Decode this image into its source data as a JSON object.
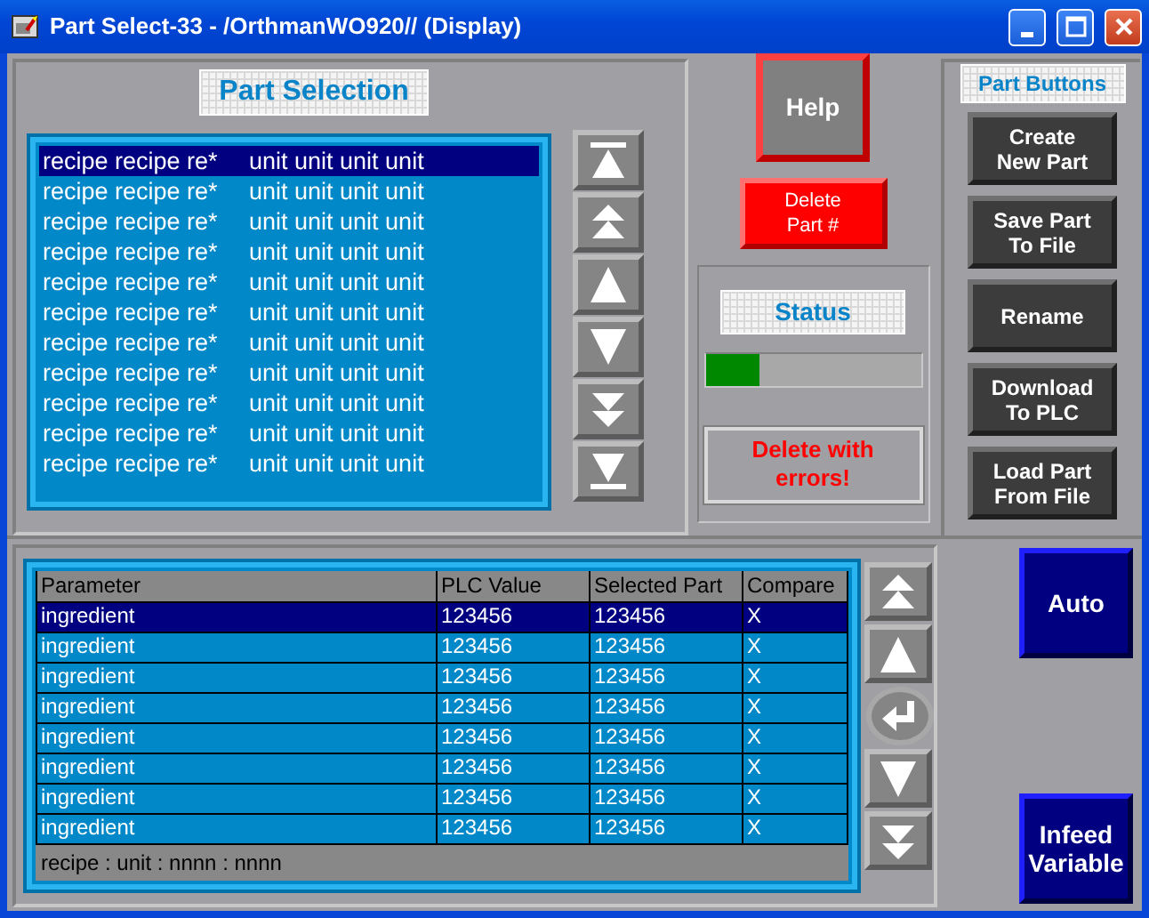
{
  "window": {
    "title": "Part Select-33 - /OrthmanWO920// (Display)"
  },
  "part_selection": {
    "title": "Part Selection",
    "items": [
      {
        "recipe": "recipe recipe re*",
        "unit": "unit unit unit unit",
        "selected": true
      },
      {
        "recipe": "recipe recipe re*",
        "unit": "unit unit unit unit",
        "selected": false
      },
      {
        "recipe": "recipe recipe re*",
        "unit": "unit unit unit unit",
        "selected": false
      },
      {
        "recipe": "recipe recipe re*",
        "unit": "unit unit unit unit",
        "selected": false
      },
      {
        "recipe": "recipe recipe re*",
        "unit": "unit unit unit unit",
        "selected": false
      },
      {
        "recipe": "recipe recipe re*",
        "unit": "unit unit unit unit",
        "selected": false
      },
      {
        "recipe": "recipe recipe re*",
        "unit": "unit unit unit unit",
        "selected": false
      },
      {
        "recipe": "recipe recipe re*",
        "unit": "unit unit unit unit",
        "selected": false
      },
      {
        "recipe": "recipe recipe re*",
        "unit": "unit unit unit unit",
        "selected": false
      },
      {
        "recipe": "recipe recipe re*",
        "unit": "unit unit unit unit",
        "selected": false
      },
      {
        "recipe": "recipe recipe re*",
        "unit": "unit unit unit unit",
        "selected": false
      }
    ],
    "scroll_buttons": [
      {
        "kind": "top"
      },
      {
        "kind": "page_up"
      },
      {
        "kind": "up"
      },
      {
        "kind": "down"
      },
      {
        "kind": "page_down"
      },
      {
        "kind": "bottom"
      }
    ]
  },
  "help_button": "Help",
  "delete_button": [
    "Delete",
    "Part #"
  ],
  "status": {
    "title": "Status",
    "level": 0.25,
    "message": "Delete with errors!"
  },
  "part_buttons": {
    "title": "Part Buttons",
    "buttons": [
      [
        "Create",
        "New Part"
      ],
      [
        "Save Part",
        "To File"
      ],
      [
        "Rename"
      ],
      [
        "Download",
        "To PLC"
      ],
      [
        "Load Part",
        "From File"
      ]
    ]
  },
  "parameters": {
    "columns": [
      "Parameter",
      "PLC Value",
      "Selected Part",
      "Compare"
    ],
    "rows": [
      {
        "cells": [
          "ingredient",
          "123456",
          "123456",
          "X"
        ],
        "selected": true
      },
      {
        "cells": [
          "ingredient",
          "123456",
          "123456",
          "X"
        ],
        "selected": false
      },
      {
        "cells": [
          "ingredient",
          "123456",
          "123456",
          "X"
        ],
        "selected": false
      },
      {
        "cells": [
          "ingredient",
          "123456",
          "123456",
          "X"
        ],
        "selected": false
      },
      {
        "cells": [
          "ingredient",
          "123456",
          "123456",
          "X"
        ],
        "selected": false
      },
      {
        "cells": [
          "ingredient",
          "123456",
          "123456",
          "X"
        ],
        "selected": false
      },
      {
        "cells": [
          "ingredient",
          "123456",
          "123456",
          "X"
        ],
        "selected": false
      },
      {
        "cells": [
          "ingredient",
          "123456",
          "123456",
          "X"
        ],
        "selected": false
      }
    ],
    "footer": "recipe : unit : nnnn : nnnn",
    "nav_buttons": [
      {
        "kind": "page_up"
      },
      {
        "kind": "up"
      },
      {
        "kind": "enter"
      },
      {
        "kind": "down"
      },
      {
        "kind": "page_down"
      }
    ]
  },
  "mode_buttons": [
    [
      "Auto"
    ],
    [
      "Infeed",
      "Variable"
    ]
  ]
}
